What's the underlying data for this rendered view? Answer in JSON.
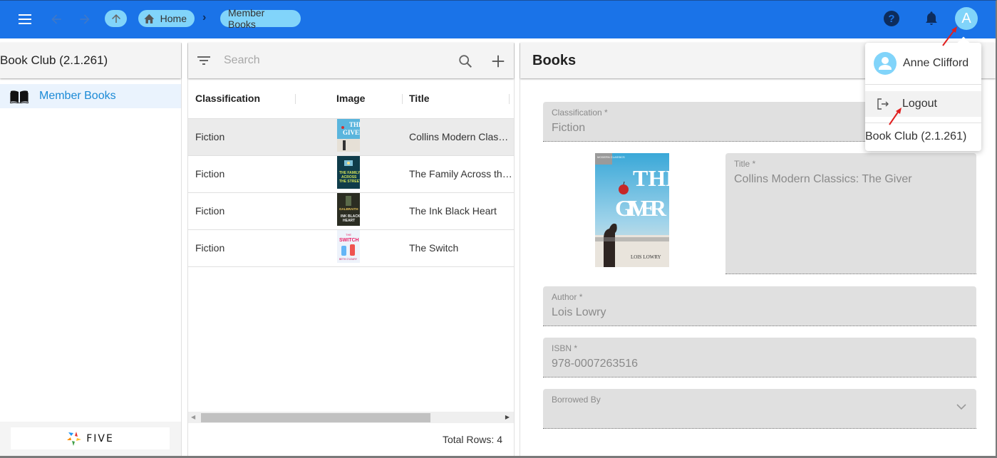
{
  "topbar": {
    "breadcrumbs": [
      {
        "label": "Home",
        "icon": "home-icon"
      },
      {
        "label": "Member Books"
      }
    ],
    "separator": "›",
    "help_label": "?",
    "avatar_initial": "A",
    "colors": {
      "bar": "#1a73e8",
      "chip": "#81d4fa",
      "dark": "#0d2c5c"
    }
  },
  "sidebar": {
    "app_title": "Book Club (2.1.261)",
    "items": [
      {
        "label": "Member Books",
        "icon": "open-book-icon",
        "active": true
      }
    ],
    "footer_logo": "FIVE"
  },
  "list": {
    "search": {
      "placeholder": "Search",
      "value": ""
    },
    "columns": [
      "Classification",
      "Image",
      "Title"
    ],
    "rows": [
      {
        "classification": "Fiction",
        "image": "The Giver cover",
        "title": "Collins Modern Classics: The Giver",
        "selected": true
      },
      {
        "classification": "Fiction",
        "image": "The Family Across the Street cover",
        "title": "The Family Across the Street",
        "selected": false
      },
      {
        "classification": "Fiction",
        "image": "The Ink Black Heart cover",
        "title": "The Ink Black Heart",
        "selected": false
      },
      {
        "classification": "Fiction",
        "image": "The Switch cover",
        "title": "The Switch",
        "selected": false
      }
    ],
    "total_rows_label": "Total Rows: 4"
  },
  "form": {
    "title": "Books",
    "fields": {
      "classification": {
        "label": "Classification *",
        "value": "Fiction"
      },
      "title": {
        "label": "Title *",
        "value": "Collins Modern Classics: The Giver"
      },
      "author": {
        "label": "Author *",
        "value": "Lois Lowry"
      },
      "isbn": {
        "label": "ISBN *",
        "value": "978-0007263516"
      },
      "borrowed_by": {
        "label": "Borrowed By",
        "value": ""
      }
    },
    "cover": {
      "title_line1": "THE",
      "title_line2": "GIVER",
      "author": "LOIS LOWRY",
      "series": "MODERN CLASSICS"
    }
  },
  "user_menu": {
    "user_name": "Anne Clifford",
    "logout_label": "Logout",
    "app_version": "Book Club (2.1.261)"
  }
}
